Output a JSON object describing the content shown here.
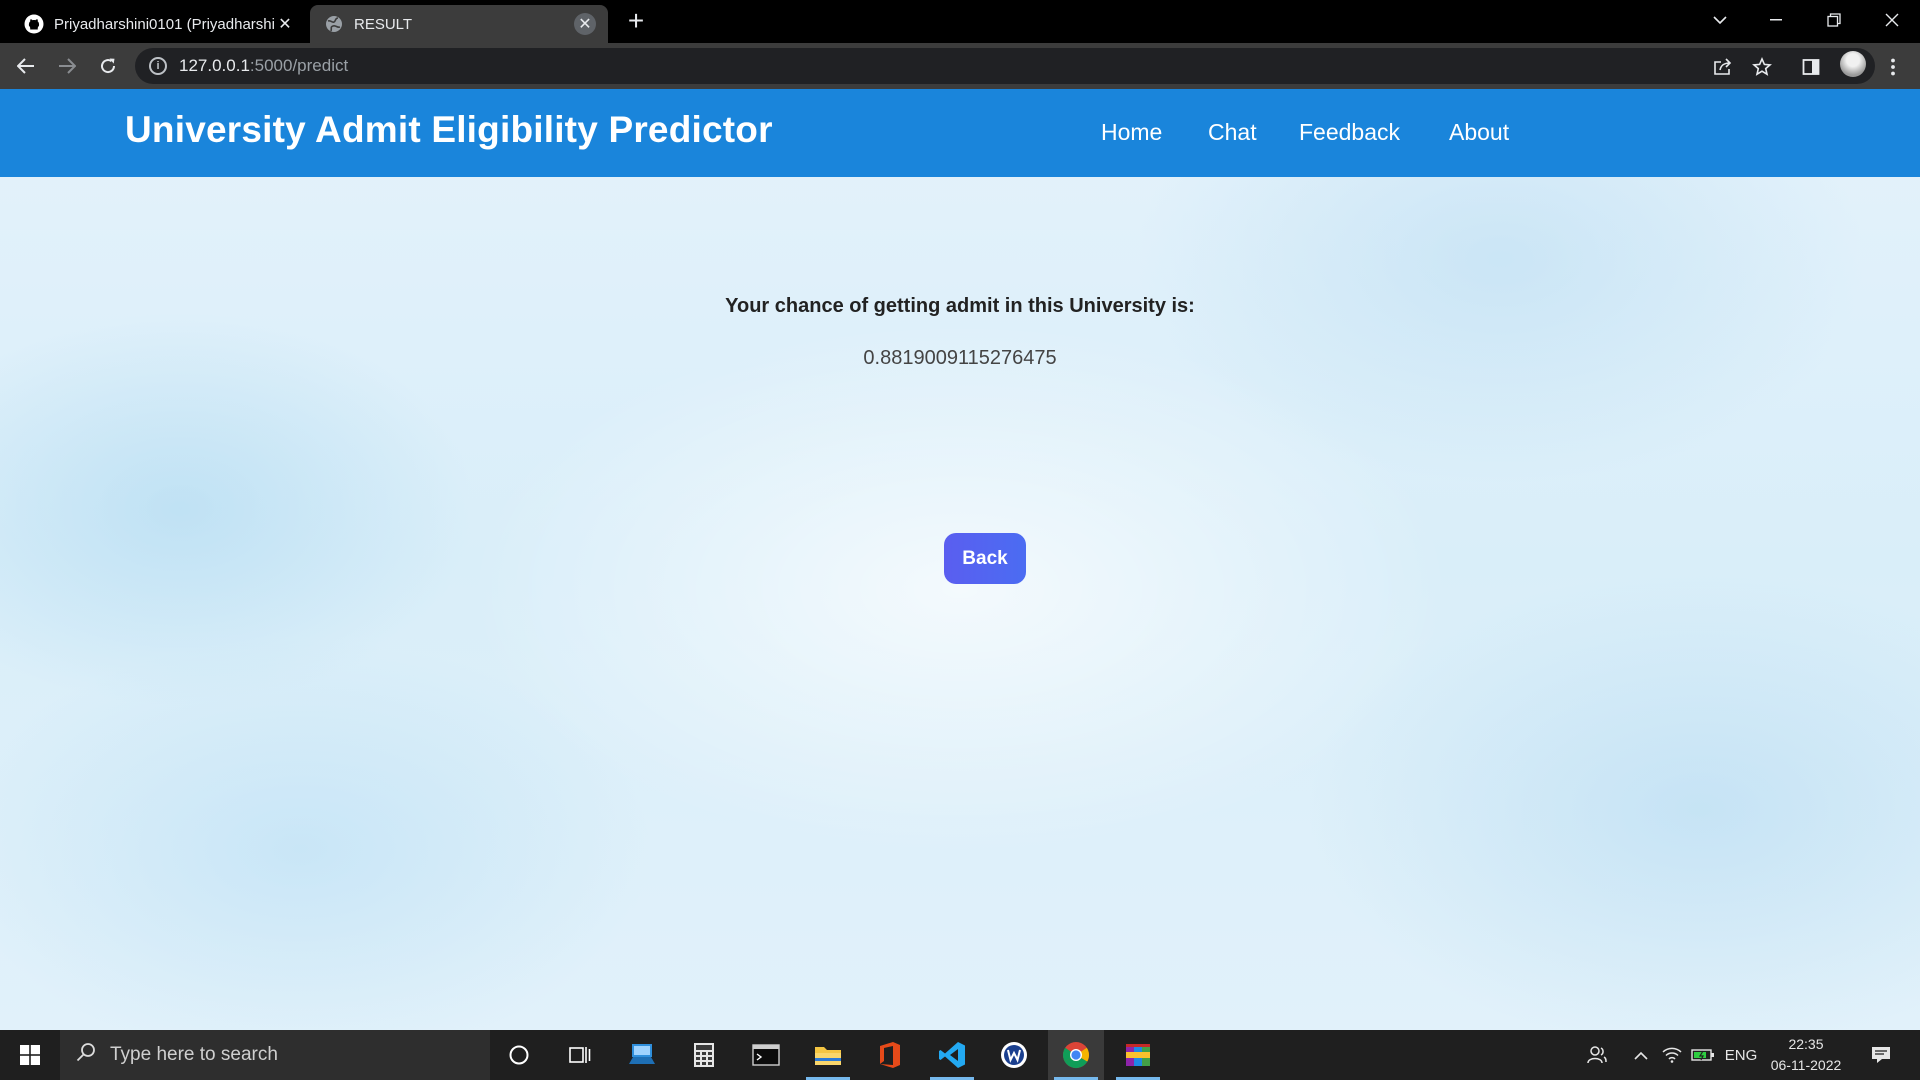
{
  "browser": {
    "tabs": [
      {
        "title": "Priyadharshini0101 (Priyadharshini",
        "icon": "github-icon",
        "active": false
      },
      {
        "title": "RESULT",
        "icon": "globe-icon",
        "active": true
      }
    ],
    "address": {
      "host": "127.0.0.1",
      "path": ":5000/predict"
    }
  },
  "site": {
    "brand": "University Admit Eligibility Predictor",
    "nav": [
      "Home",
      "Chat",
      "Feedback",
      "About"
    ],
    "nav_color": "#1a85db"
  },
  "result": {
    "label": "Your chance of getting admit in this University is:",
    "value": "0.8819009115276475",
    "back_label": "Back",
    "button_color": "#5a5ef0"
  },
  "taskbar": {
    "search_placeholder": "Type here to search",
    "tray": {
      "language": "ENG",
      "time": "22:35",
      "date": "06-11-2022"
    }
  }
}
